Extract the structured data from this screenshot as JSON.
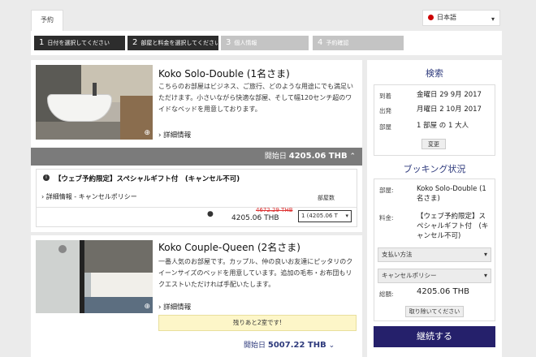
{
  "header": {
    "tab_label": "予約",
    "language": "日本語"
  },
  "steps": [
    {
      "num": "1",
      "label": "日付を選択してください"
    },
    {
      "num": "2",
      "label": "部屋と料金を選択してください"
    },
    {
      "num": "3",
      "label": "個人情報"
    },
    {
      "num": "4",
      "label": "予約確認"
    }
  ],
  "rooms": [
    {
      "title": "Koko Solo-Double (1名さま)",
      "desc": "こちらのお部屋はビジネス、ご旅行、どのような用途にでも満足いただけます。小さいながら快適な部屋、そして幅120センチ超のワイドなベッドを用意しております。",
      "details_link": "詳細情報",
      "price_label": "開始日",
      "price": "4205.06 THB",
      "rate": {
        "title": "【ウェブ予約限定】スペシャルギフト付　(キャンセル不可)",
        "policy_link": "詳細情報 - キャンセルポリシー",
        "rooms_label": "部屋数",
        "old_price": "4672.29 THB",
        "price": "4205.06 THB",
        "select_value": "1 (4205.06 T"
      }
    },
    {
      "title": "Koko Couple-Queen (2名さま)",
      "desc": "一番人気のお部屋です。カップル、仲の良いお友達にピッタリのクイーンサイズのベッドを用意しています。追加の毛布・お布団もリクエストいただければ手配いたします。",
      "details_link": "詳細情報",
      "notice": "残りあと2室です!",
      "price_label": "開始日",
      "price": "5007.22 THB"
    }
  ],
  "search": {
    "title": "検索",
    "checkin_label": "到着",
    "checkin": "金曜日 29 9月 2017",
    "checkout_label": "出発",
    "checkout": "月曜日 2 10月 2017",
    "rooms_label": "部屋",
    "rooms": "1 部屋 の 1 大人",
    "change_button": "変更"
  },
  "booking": {
    "title": "ブッキング状況",
    "room_label": "部屋:",
    "room": "Koko Solo-Double (1名さま)",
    "rate_label": "料金:",
    "rate": "【ウェブ予約限定】スペシャルギフト付　(キャンセル不可)",
    "payment_select": "支払い方法",
    "cancel_select": "キャンセルポリシー",
    "total_label": "総額:",
    "total": "4205.06 THB",
    "remove_button": "取り除いてください",
    "continue_button": "継続する"
  }
}
